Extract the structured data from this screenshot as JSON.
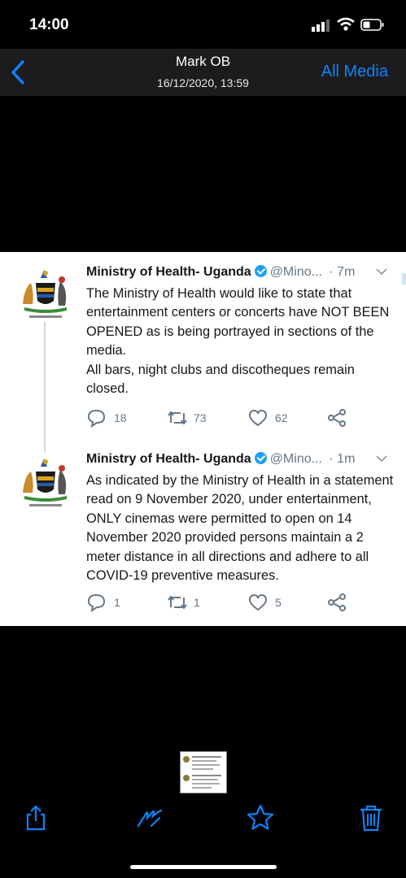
{
  "status_bar": {
    "time": "14:00"
  },
  "nav": {
    "title": "Mark OB",
    "subtitle": "16/12/2020, 13:59",
    "all_media": "All Media"
  },
  "colors": {
    "accent": "#0a84ff",
    "twitter_blue": "#1da1f2",
    "secondary_text": "#657786"
  },
  "tweets": [
    {
      "name": "Ministry of Health- Uganda",
      "handle": "@Mino...",
      "time": "· 7m",
      "text": "The Ministry of Health would like to state that entertainment centers or concerts have NOT BEEN OPENED as is being portrayed in sections of the media.\nAll bars, night clubs and discotheques remain closed.",
      "replies": "18",
      "retweets": "73",
      "likes": "62"
    },
    {
      "name": "Ministry of Health- Uganda",
      "handle": "@Mino...",
      "time": "· 1m",
      "text": "As indicated by the Ministry of Health in a statement read on 9 November 2020, under entertainment, ONLY cinemas were permitted to open on 14 November 2020 provided persons maintain a 2 meter distance in all directions and adhere to all COVID-19 preventive measures.",
      "replies": "1",
      "retweets": "1",
      "likes": "5"
    }
  ],
  "icons": {
    "toolbar": [
      "share-icon",
      "markup-icon",
      "star-icon",
      "trash-icon"
    ],
    "tweet_actions": [
      "reply-icon",
      "retweet-icon",
      "like-icon",
      "share-icon"
    ]
  }
}
